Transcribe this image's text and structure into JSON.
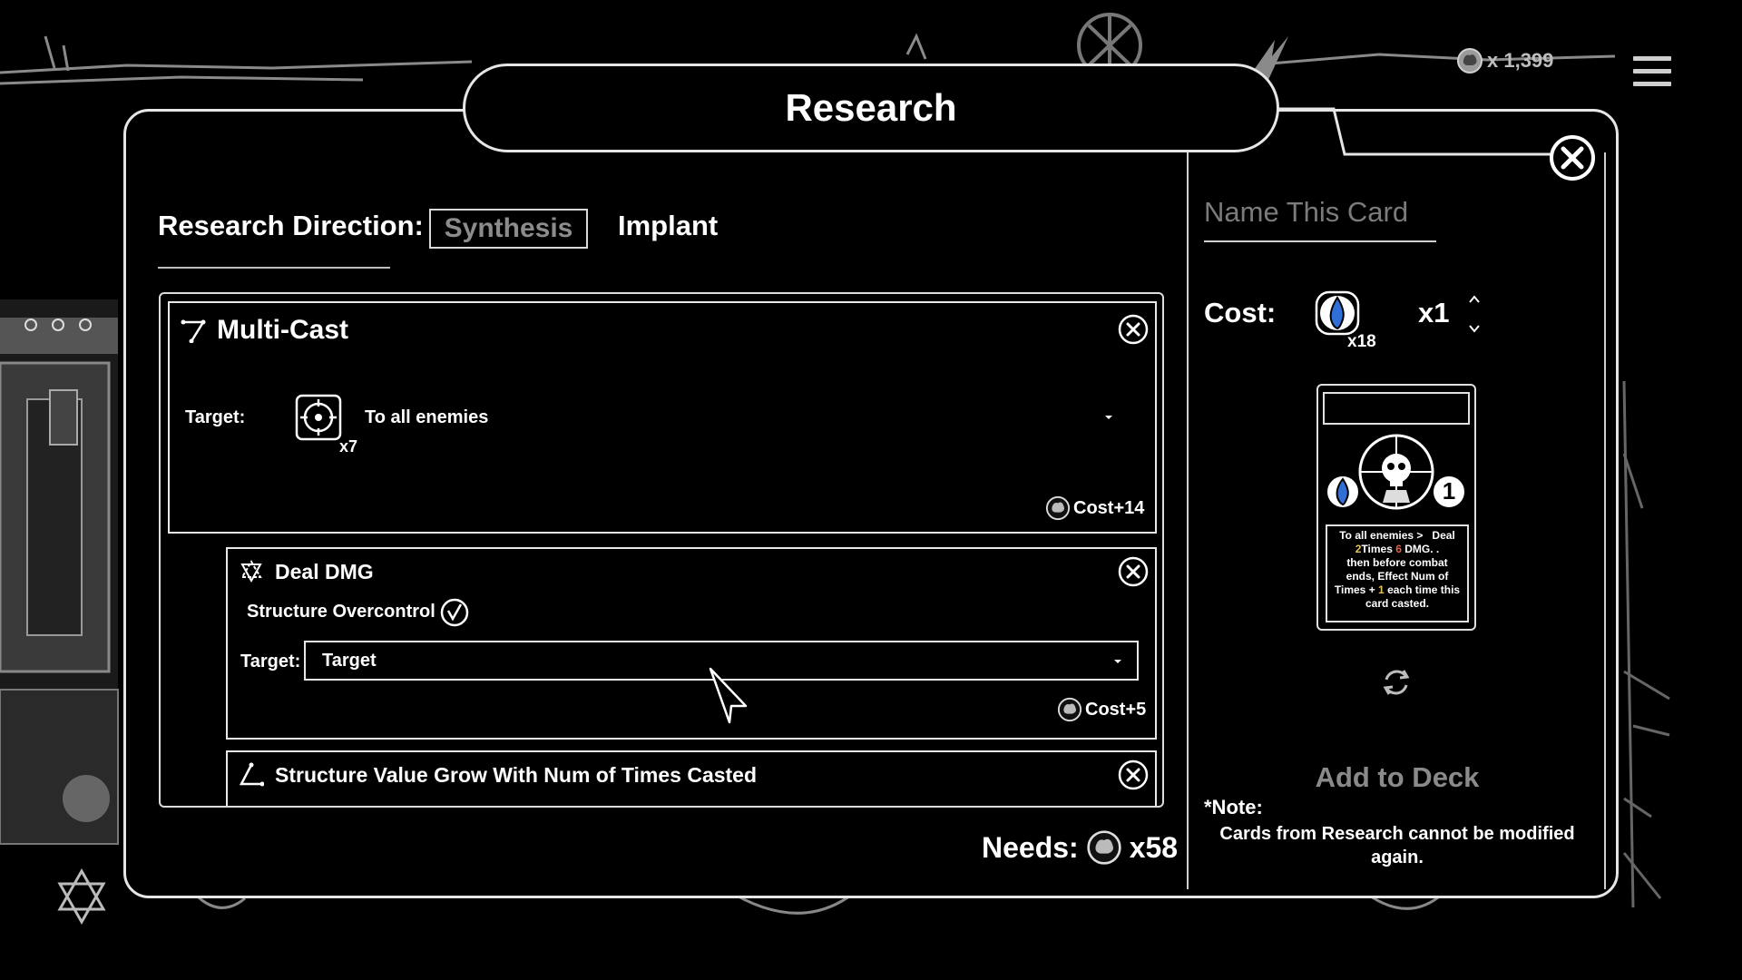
{
  "hud": {
    "currency_amount": "x 1,399",
    "currency_icon": "brain-coin-icon",
    "menu_icon": "menu-lines-icon"
  },
  "window": {
    "title": "Research"
  },
  "direction": {
    "label": "Research Direction:",
    "tabs": [
      {
        "label": "Synthesis",
        "selected": true
      },
      {
        "label": "Implant",
        "selected": false
      }
    ]
  },
  "effects": [
    {
      "title": "Multi-Cast",
      "icon": "multi-cast-icon",
      "target_label": "Target:",
      "target_icon": "crosshair-icon",
      "target_count": "x7",
      "target_value": "To all enemies",
      "cost": "Cost+14"
    },
    {
      "title": "Deal DMG",
      "icon": "deal-dmg-icon",
      "option_label": "Structure Overcontrol",
      "option_checked": true,
      "target_label": "Target:",
      "target_value": "Target",
      "cost": "Cost+5"
    },
    {
      "title": "Structure Value Grow With Num of Times Casted",
      "icon": "angle-icon"
    }
  ],
  "needs": {
    "label": "Needs:",
    "amount": "x58"
  },
  "card_builder": {
    "name_placeholder": "Name This Card",
    "cost_label": "Cost:",
    "cost_icon": "blue-flame-icon",
    "cost_icon_count": "x18",
    "cost_value": "x1",
    "preview": {
      "cost_number": "1",
      "desc_parts": {
        "p1": "To all enemies >",
        "p2": "Deal",
        "n1": "2",
        "p3": "Times",
        "n2": "6",
        "p4": "DMG. .",
        "p5": "then",
        "p6": "before combat ends,",
        "p7": "Effect Num of Times +",
        "n3": "1",
        "p8": "each time this card casted."
      }
    },
    "refresh_icon": "refresh-icon",
    "add_to_deck": "Add to Deck",
    "note_label": "*Note:",
    "note_text": "Cards from Research cannot be modified again."
  },
  "colors": {
    "background": "#000000",
    "border": "#e6e6e6",
    "muted_text": "#8a8a8a",
    "accent_blue": "#2f6fd6",
    "highlight_gold": "#e6c65a",
    "highlight_red": "#e0604a"
  }
}
